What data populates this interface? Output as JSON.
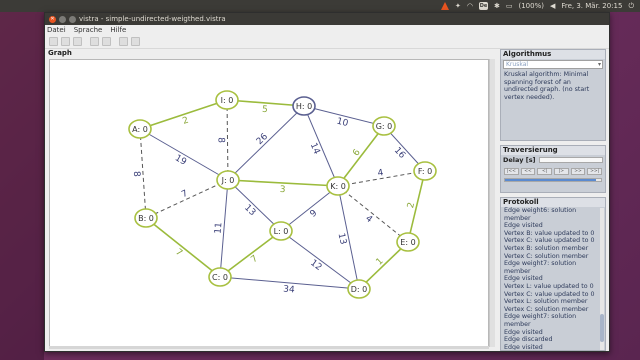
{
  "desktop": {
    "panel": {
      "battery": "(100%)",
      "clock": "Fre, 3. Mär. 20:15"
    }
  },
  "window": {
    "title": "vistra - simple-undirected-weigthed.vistra",
    "menu": [
      "Datei",
      "Sprache",
      "Hilfe"
    ],
    "toolbar_icons": [
      "new-file-icon",
      "open-file-icon",
      "save-file-icon",
      "graph-icon",
      "copy-icon",
      "export-icon",
      "image-icon"
    ]
  },
  "graph_panel": {
    "title": "Graph",
    "nodes": [
      {
        "id": "A",
        "label": "A: 0",
        "highlight": true
      },
      {
        "id": "I",
        "label": "I: 0",
        "highlight": true
      },
      {
        "id": "H",
        "label": "H: 0",
        "highlight": false
      },
      {
        "id": "G",
        "label": "G: 0",
        "highlight": true
      },
      {
        "id": "F",
        "label": "F: 0",
        "highlight": true
      },
      {
        "id": "J",
        "label": "J: 0",
        "highlight": true
      },
      {
        "id": "K",
        "label": "K: 0",
        "highlight": true
      },
      {
        "id": "B",
        "label": "B: 0",
        "highlight": true
      },
      {
        "id": "L",
        "label": "L: 0",
        "highlight": true
      },
      {
        "id": "E",
        "label": "E: 0",
        "highlight": true
      },
      {
        "id": "C",
        "label": "C: 0",
        "highlight": true
      },
      {
        "id": "D",
        "label": "D: 0",
        "highlight": true
      }
    ],
    "edges": [
      {
        "from": "A",
        "to": "I",
        "weight": "2",
        "state": "solution"
      },
      {
        "from": "I",
        "to": "H",
        "weight": "5",
        "state": "solution"
      },
      {
        "from": "H",
        "to": "G",
        "weight": "10",
        "state": "normal"
      },
      {
        "from": "G",
        "to": "F",
        "weight": "16",
        "state": "normal"
      },
      {
        "from": "A",
        "to": "J",
        "weight": "19",
        "state": "normal"
      },
      {
        "from": "I",
        "to": "J",
        "weight": "8",
        "state": "discarded"
      },
      {
        "from": "H",
        "to": "J",
        "weight": "26",
        "state": "normal"
      },
      {
        "from": "H",
        "to": "K",
        "weight": "14",
        "state": "normal"
      },
      {
        "from": "G",
        "to": "K",
        "weight": "6",
        "state": "solution"
      },
      {
        "from": "F",
        "to": "K",
        "weight": "4",
        "state": "discarded"
      },
      {
        "from": "A",
        "to": "B",
        "weight": "8",
        "state": "discarded"
      },
      {
        "from": "J",
        "to": "K",
        "weight": "3",
        "state": "solution"
      },
      {
        "from": "J",
        "to": "B",
        "weight": "7",
        "state": "discarded"
      },
      {
        "from": "J",
        "to": "L",
        "weight": "13",
        "state": "normal"
      },
      {
        "from": "J",
        "to": "C",
        "weight": "11",
        "state": "normal"
      },
      {
        "from": "L",
        "to": "K",
        "weight": "9",
        "state": "normal"
      },
      {
        "from": "K",
        "to": "E",
        "weight": "4",
        "state": "discarded"
      },
      {
        "from": "K",
        "to": "D",
        "weight": "13",
        "state": "normal"
      },
      {
        "from": "F",
        "to": "E",
        "weight": "2",
        "state": "solution"
      },
      {
        "from": "B",
        "to": "C",
        "weight": "7",
        "state": "solution"
      },
      {
        "from": "C",
        "to": "L",
        "weight": "7",
        "state": "solution"
      },
      {
        "from": "C",
        "to": "D",
        "weight": "34",
        "state": "normal"
      },
      {
        "from": "L",
        "to": "D",
        "weight": "12",
        "state": "normal"
      },
      {
        "from": "E",
        "to": "D",
        "weight": "1",
        "state": "solution"
      }
    ]
  },
  "algorithm_panel": {
    "title": "Algorithmus",
    "selected": "Kruskal",
    "description": "Kruskal algorithm: Minimal spanning forest of an undirected graph. (no start vertex needed)."
  },
  "traversal_panel": {
    "title": "Traversierung",
    "delay_label": "Delay [s]",
    "buttons": [
      "|<<",
      "<<",
      "<|",
      "|>",
      ">>",
      ">>|"
    ],
    "progress": 0.95
  },
  "protocol_panel": {
    "title": "Protokoll",
    "entries": [
      "Edge weight6: solution member",
      "Edge visited",
      "Vertex B: value updated to 0",
      "Vertex C: value updated to 0",
      "Vertex B: solution member",
      "Vertex C: solution member",
      "Edge weight7: solution member",
      "Edge visited",
      "Vertex L: value updated to 0",
      "Vertex C: value updated to 0",
      "Vertex L: solution member",
      "Vertex C: solution member",
      "Edge weight7: solution member",
      "Edge visited",
      "Edge discarded",
      "Edge visited",
      "Edge discarded",
      "Edge visited",
      "Edge discarded"
    ]
  },
  "colors": {
    "solution": "#9bbb3c",
    "normal": "#5a5f90",
    "discarded": "#555555",
    "node_border": "#a8c040",
    "accent": "#e95420"
  }
}
